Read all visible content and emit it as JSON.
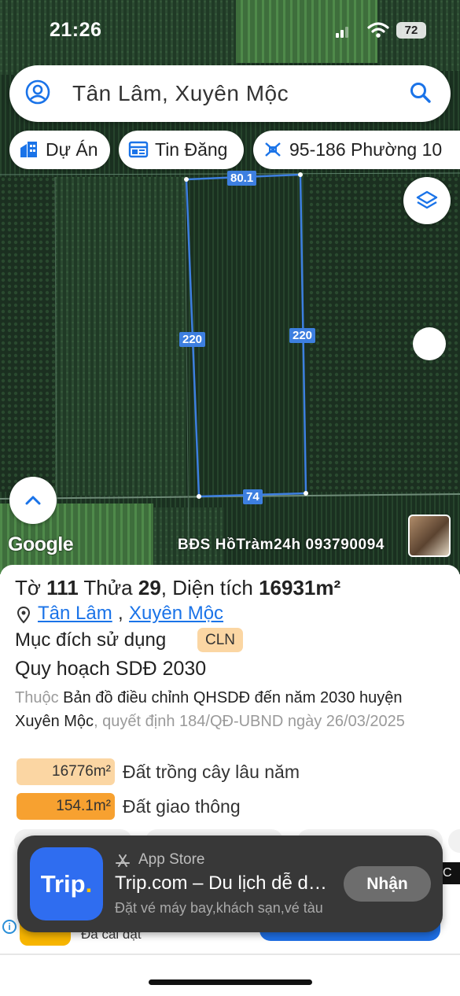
{
  "status_bar": {
    "time": "21:26",
    "battery": "72"
  },
  "search": {
    "query": "Tân Lâm, Xuyên Mộc"
  },
  "chips": [
    {
      "label": "Dự Án",
      "icon": "building-icon"
    },
    {
      "label": "Tin Đăng",
      "icon": "listing-icon"
    },
    {
      "label": "95-186 Phường 10",
      "icon": "parcel-icon"
    }
  ],
  "map": {
    "segments": {
      "top": "80.1",
      "left": "220",
      "right": "220",
      "bottom": "74"
    },
    "attribution": "Google",
    "watermark": "BĐS HồTràm24h 093790094",
    "boundary_color": "#3d7fe0"
  },
  "parcel": {
    "prefix": "Tờ ",
    "sheet_no": "111",
    "plot_label": " Thửa ",
    "plot_no": "29",
    "area_label": ", Diện tích ",
    "area_value": "16931m²",
    "location_ward": "Tân Lâm",
    "location_sep": ",",
    "location_district": "Xuyên Mộc",
    "purpose_label": "Mục đích sử dụng",
    "purpose_code": "CLN",
    "plan_title": "Quy hoạch SDĐ 2030",
    "plan_prefix": "Thuộc ",
    "plan_name": "Bản đồ điều chỉnh QHSDĐ đến năm 2030 huyện Xuyên Mộc",
    "plan_decision": ", quyết định 184/QĐ-UBND ngày 26/03/2025",
    "land_use": [
      {
        "area": "16776m²",
        "label": "Đất trồng cây lâu năm",
        "color": "#fbd6a3"
      },
      {
        "area": "154.1m²",
        "label": "Đất giao thông",
        "color": "#f7a130"
      }
    ]
  },
  "ad": {
    "icon_text": "Trip",
    "icon_dot": ".",
    "store": "App Store",
    "title": "Trip.com – Du lịch dễ dàng",
    "subtitle": "Đặt vé máy bay,khách sạn,vé tàu",
    "button": "Nhận"
  },
  "peek": {
    "installed": "Đã cài đặt",
    "c": "C"
  }
}
